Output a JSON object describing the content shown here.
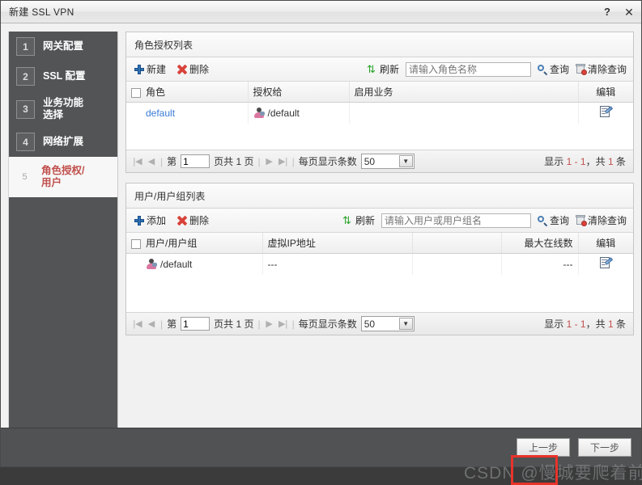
{
  "window": {
    "title": "新建 SSL VPN",
    "help_label": "?",
    "close_label": "✕"
  },
  "sidebar": {
    "steps": [
      {
        "num": "1",
        "label": "网关配置",
        "active": false
      },
      {
        "num": "2",
        "label": "SSL 配置",
        "active": false
      },
      {
        "num": "3",
        "label": "业务功能选择",
        "active": false
      },
      {
        "num": "4",
        "label": "网络扩展",
        "active": false
      },
      {
        "num": "5",
        "label": "角色授权/用户",
        "active": true
      }
    ]
  },
  "role_panel": {
    "title": "角色授权列表",
    "toolbar": {
      "new_label": "新建",
      "delete_label": "删除",
      "refresh_label": "刷新",
      "search_placeholder": "请输入角色名称",
      "search_value": "",
      "query_label": "查询",
      "clear_label": "清除查询"
    },
    "columns": [
      "角色",
      "授权给",
      "启用业务",
      "编辑"
    ],
    "rows": [
      {
        "role": "default",
        "granted_to": "/default",
        "services": "",
        "edit": "edit-icon"
      }
    ],
    "pager": {
      "first": "|◀",
      "prev": "◀",
      "page_prefix": "第",
      "page_value": "1",
      "page_suffix": "页共 1 页",
      "next": "▶",
      "last": "▶|",
      "per_page_label": "每页显示条数",
      "per_page_value": "50",
      "summary_prefix": "显示",
      "summary_range": "1 - 1",
      "summary_mid": "，共",
      "summary_count": "1",
      "summary_suffix": "条"
    }
  },
  "user_panel": {
    "title": "用户/用户组列表",
    "toolbar": {
      "add_label": "添加",
      "delete_label": "删除",
      "refresh_label": "刷新",
      "search_placeholder": "请输入用户或用户组名",
      "search_value": "",
      "query_label": "查询",
      "clear_label": "清除查询"
    },
    "columns": [
      "用户/用户组",
      "虚拟IP地址",
      "",
      "最大在线数",
      "编辑"
    ],
    "rows": [
      {
        "user": "/default",
        "virtual_ip": "---",
        "max_online": "---",
        "edit": "edit-icon"
      }
    ],
    "pager": {
      "first": "|◀",
      "prev": "◀",
      "page_prefix": "第",
      "page_value": "1",
      "page_suffix": "页共 1 页",
      "next": "▶",
      "last": "▶|",
      "per_page_label": "每页显示条数",
      "per_page_value": "50",
      "summary_prefix": "显示",
      "summary_range": "1 - 1",
      "summary_mid": "，共",
      "summary_count": "1",
      "summary_suffix": "条"
    }
  },
  "footer": {
    "back_label": "上一步",
    "next_label": "下一步"
  },
  "watermark": {
    "text": "CSDN @慢城要爬着前进"
  },
  "colors": {
    "accent": "#c0504d",
    "link": "#3a7bd5",
    "sidebar_bg": "#525456",
    "footer_bg": "#505254",
    "annotation": "#e8332a"
  }
}
